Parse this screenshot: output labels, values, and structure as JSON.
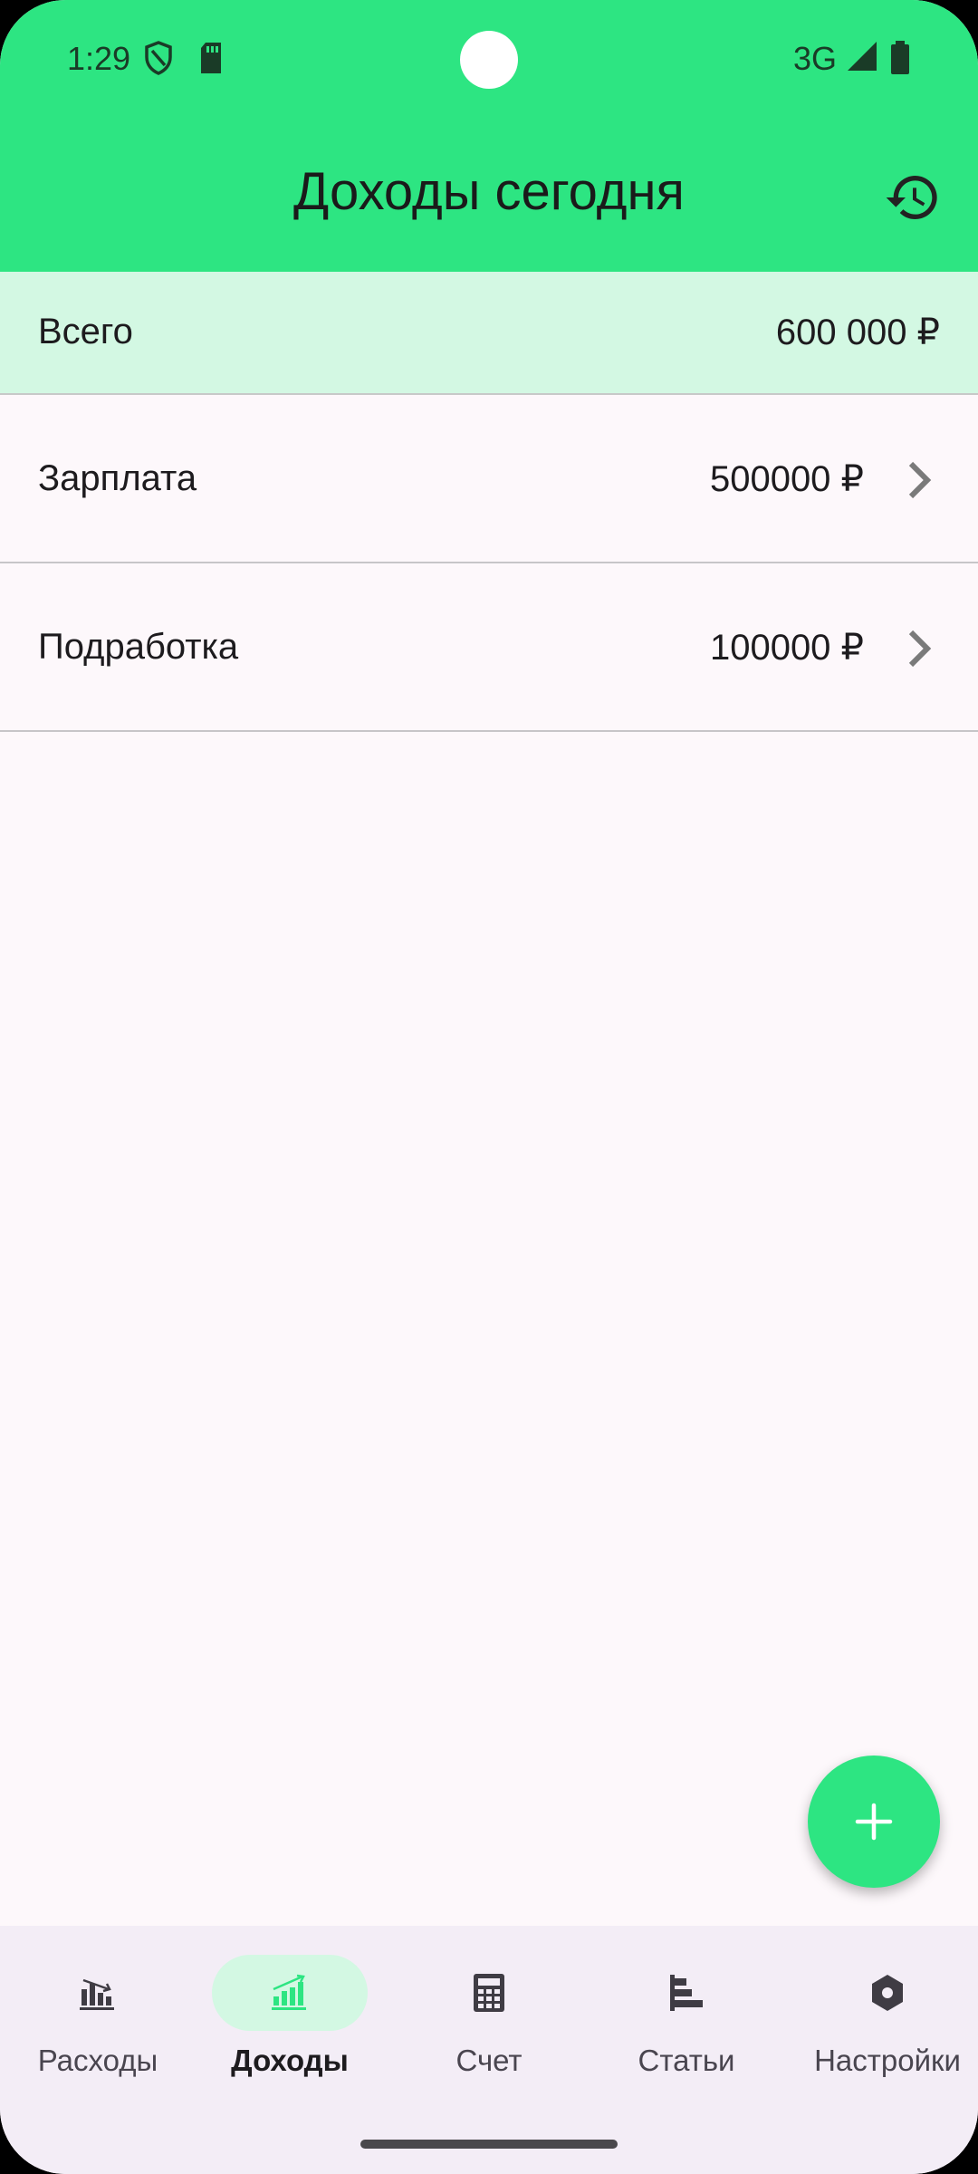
{
  "status_bar": {
    "time": "1:29",
    "network": "3G",
    "icons": [
      "shield-icon",
      "sd-card-icon",
      "signal-icon",
      "battery-icon"
    ]
  },
  "app_bar": {
    "title": "Доходы сегодня",
    "action_icon": "history-icon"
  },
  "summary": {
    "label": "Всего",
    "value": "600 000 ₽"
  },
  "income_items": [
    {
      "label": "Зарплата",
      "value": "500000 ₽"
    },
    {
      "label": "Подработка",
      "value": "100000 ₽"
    }
  ],
  "fab": {
    "icon": "plus-icon"
  },
  "bottom_nav": {
    "items": [
      {
        "label": "Расходы",
        "icon": "expenses-chart-icon",
        "active": false
      },
      {
        "label": "Доходы",
        "icon": "income-chart-icon",
        "active": true
      },
      {
        "label": "Счет",
        "icon": "calculator-icon",
        "active": false
      },
      {
        "label": "Статьи",
        "icon": "articles-icon",
        "active": false
      },
      {
        "label": "Настройки",
        "icon": "settings-icon",
        "active": false
      }
    ]
  },
  "colors": {
    "accent": "#2de582",
    "accent_light": "#d3f8e3",
    "background": "#fdf8fb",
    "nav_background": "#f3edf6"
  }
}
